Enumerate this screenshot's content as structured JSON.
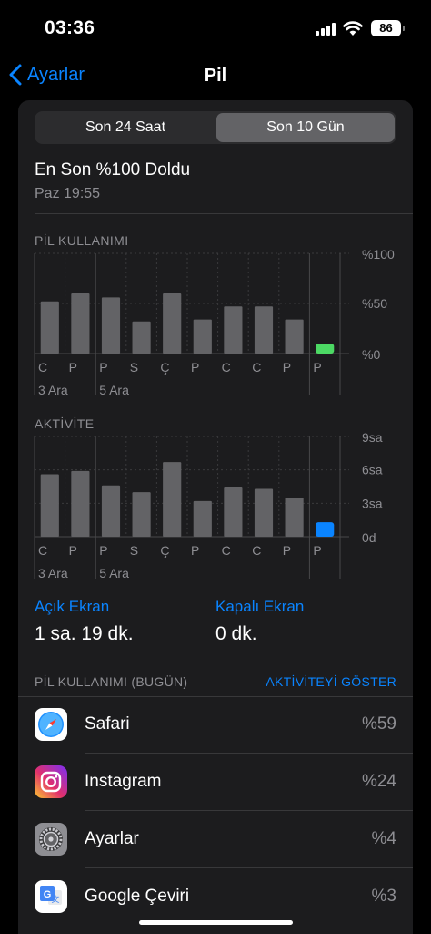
{
  "status_bar": {
    "time": "03:36",
    "battery": "86"
  },
  "nav": {
    "back_label": "Ayarlar",
    "title": "Pil"
  },
  "segments": [
    "Son 24 Saat",
    "Son 10 Gün"
  ],
  "last_charged": {
    "title": "En Son %100 Doldu",
    "time": "Paz 19:55"
  },
  "colors": {
    "accent": "#0a84ff",
    "bar": "#636366",
    "battery_today": "#4cd964",
    "activity_today": "#0a84ff"
  },
  "chart_data": [
    {
      "type": "bar",
      "title": "PİL KULLANIMI",
      "categories": [
        "C",
        "P",
        "P",
        "S",
        "Ç",
        "P",
        "C",
        "C",
        "P",
        "P"
      ],
      "week_labels": [
        "3 Ara",
        "5 Ara"
      ],
      "values": [
        52,
        60,
        56,
        32,
        60,
        34,
        47,
        47,
        34,
        10
      ],
      "y_tick_labels": [
        "%100",
        "%50",
        "%0"
      ],
      "ylim": [
        0,
        100
      ]
    },
    {
      "type": "bar",
      "title": "AKTİVİTE",
      "categories": [
        "C",
        "P",
        "P",
        "S",
        "Ç",
        "P",
        "C",
        "C",
        "P",
        "P"
      ],
      "week_labels": [
        "3 Ara",
        "5 Ara"
      ],
      "values": [
        5.6,
        5.9,
        4.6,
        4.0,
        6.7,
        3.2,
        4.5,
        4.3,
        3.5,
        1.3
      ],
      "y_tick_labels": [
        "9sa",
        "6sa",
        "3sa",
        "0d"
      ],
      "ylim": [
        0,
        9
      ]
    }
  ],
  "screen_on": {
    "label": "Açık Ekran",
    "value": "1 sa. 19 dk."
  },
  "screen_off": {
    "label": "Kapalı Ekran",
    "value": "0 dk."
  },
  "app_usage": {
    "header": "PİL KULLANIMI (BUGÜN)",
    "action": "AKTİVİTEYİ GÖSTER",
    "apps": [
      {
        "name": "Safari",
        "percent": "%59",
        "icon": "safari-icon"
      },
      {
        "name": "Instagram",
        "percent": "%24",
        "icon": "instagram-icon"
      },
      {
        "name": "Ayarlar",
        "percent": "%4",
        "icon": "settings-gear-icon"
      },
      {
        "name": "Google Çeviri",
        "percent": "%3",
        "icon": "google-translate-icon"
      }
    ]
  }
}
